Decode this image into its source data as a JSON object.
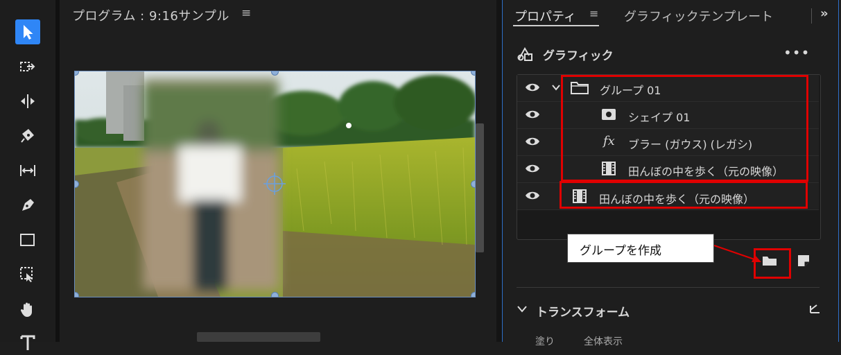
{
  "program_monitor": {
    "title": "プログラム : 9:16サンプル",
    "menu_icon": "hamburger-icon"
  },
  "tools": [
    {
      "name": "selection-tool",
      "icon": "arrow-pointer-icon",
      "active": true
    },
    {
      "name": "track-select-tool",
      "icon": "track-select-icon"
    },
    {
      "name": "ripple-edit-tool",
      "icon": "ripple-edit-icon"
    },
    {
      "name": "razor-tool",
      "icon": "razor-icon"
    },
    {
      "name": "slip-tool",
      "icon": "slip-icon"
    },
    {
      "name": "pen-tool",
      "icon": "pen-icon"
    },
    {
      "name": "rectangle-tool",
      "icon": "rectangle-icon"
    },
    {
      "name": "transform-tool",
      "icon": "transform-icon"
    },
    {
      "name": "hand-tool",
      "icon": "hand-icon"
    },
    {
      "name": "type-tool",
      "icon": "type-icon"
    }
  ],
  "properties_panel": {
    "tabs": [
      {
        "label": "プロパティ",
        "active": true
      },
      {
        "label": "グラフィックテンプレート",
        "active": false
      }
    ],
    "section_label": "グラフィック",
    "more_label": "•••",
    "layers": [
      {
        "label": "グループ 01",
        "type": "group",
        "indent": 0
      },
      {
        "label": "シェイプ 01",
        "type": "shape",
        "indent": 1
      },
      {
        "label": "ブラー (ガウス) (レガシ)",
        "type": "effect",
        "indent": 1
      },
      {
        "label": "田んぼの中を歩く（元の映像）",
        "type": "video",
        "indent": 1
      },
      {
        "label": "田んぼの中を歩く（元の映像）",
        "type": "video",
        "indent": 0
      }
    ],
    "callout_text": "グループを作成",
    "transform_label": "トランスフォーム",
    "bottom_partial": "塗り　　　全体表示"
  },
  "colors": {
    "accent_blue": "#2f86f6",
    "annotation_red": "#e00000",
    "panel_bg": "#1e1e1e"
  }
}
